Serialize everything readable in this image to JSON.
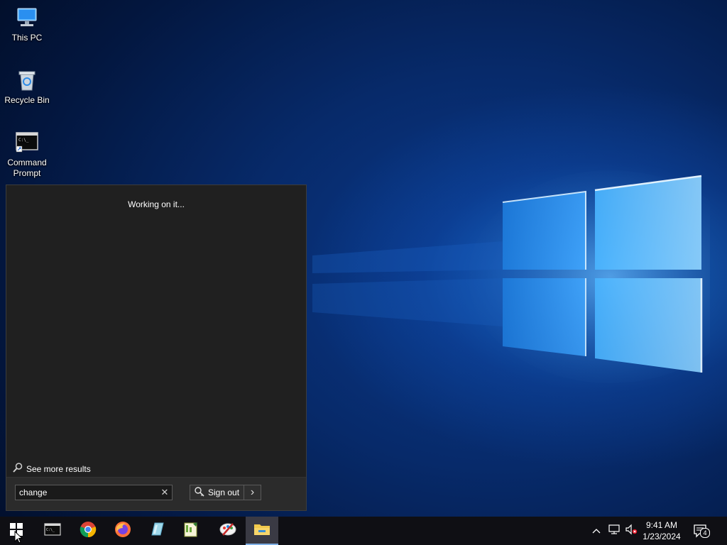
{
  "desktop": {
    "icons": [
      {
        "label_line1": "This PC",
        "label_line2": "",
        "icon": "computer-icon"
      },
      {
        "label_line1": "Recycle Bin",
        "label_line2": "",
        "icon": "recycle-bin-icon"
      },
      {
        "label_line1": "Command",
        "label_line2": "Prompt",
        "icon": "command-prompt-icon"
      }
    ]
  },
  "search_panel": {
    "status": "Working on it...",
    "see_more_label": "See more results",
    "search_value": "change",
    "clear_symbol": "✕",
    "signout_label": "Sign out",
    "signout_arrow": "›"
  },
  "taskbar": {
    "buttons": [
      {
        "name": "start-button",
        "icon": "windows-logo-icon"
      },
      {
        "name": "command-prompt-taskbar-button",
        "icon": "command-prompt-icon"
      },
      {
        "name": "chrome-taskbar-button",
        "icon": "chrome-icon"
      },
      {
        "name": "firefox-taskbar-button",
        "icon": "firefox-icon"
      },
      {
        "name": "app-taskbar-button",
        "icon": "glass-app-icon"
      },
      {
        "name": "editor-taskbar-button",
        "icon": "notepad-plus-icon"
      },
      {
        "name": "paint-taskbar-button",
        "icon": "paint-icon"
      },
      {
        "name": "file-explorer-taskbar-button",
        "icon": "folder-icon",
        "active": true
      }
    ],
    "tray": {
      "chevron": "^",
      "time": "9:41 AM",
      "date": "1/23/2024",
      "notification_count": "4"
    }
  },
  "colors": {
    "panel_bg": "#202020",
    "taskbar_bg": "#0f0f14",
    "accent": "#7fb0e6"
  }
}
